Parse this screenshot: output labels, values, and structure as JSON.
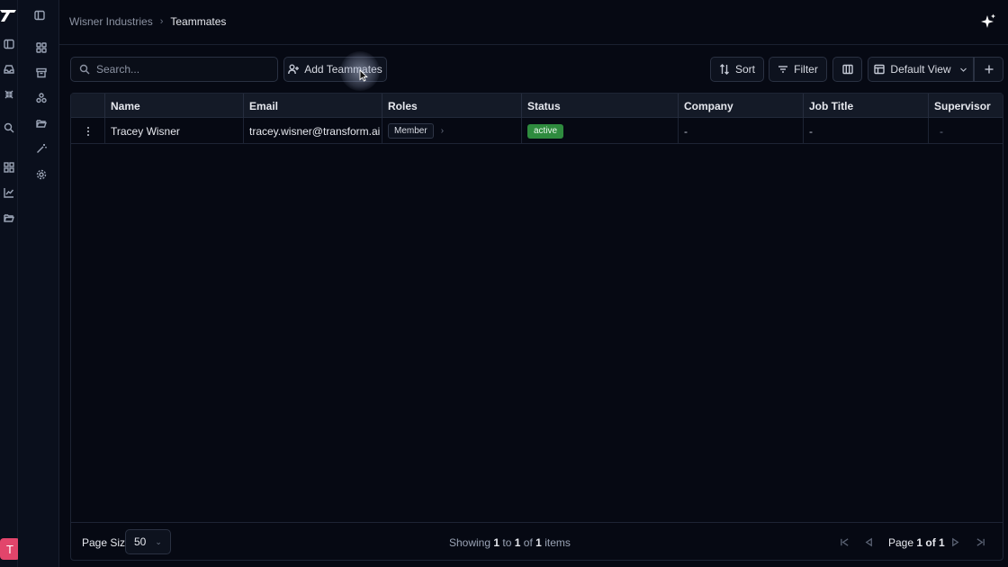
{
  "breadcrumb": {
    "org": "Wisner Industries",
    "current": "Teammates"
  },
  "toolbar": {
    "search_placeholder": "Search...",
    "add_label": "Add Teammates",
    "sort_label": "Sort",
    "filter_label": "Filter",
    "view_label": "Default View"
  },
  "table": {
    "columns": [
      "Name",
      "Email",
      "Roles",
      "Status",
      "Company",
      "Job Title",
      "Supervisor"
    ],
    "rows": [
      {
        "name": "Tracey Wisner",
        "email": "tracey.wisner@transform.ai",
        "role": "Member",
        "status": "active",
        "company": "-",
        "job_title": "-",
        "supervisor": "-"
      }
    ]
  },
  "footer": {
    "page_size_label": "Page Size",
    "page_size_value": "50",
    "showing_prefix": "Showing",
    "showing_from": "1",
    "showing_to_word": "to",
    "showing_to": "1",
    "showing_of_word": "of",
    "showing_total": "1",
    "showing_suffix": "items",
    "page_word": "Page",
    "page_current_label": "1 of 1"
  },
  "user": {
    "avatar_initial": "T"
  },
  "colors": {
    "accent_status": "#2e8b3e",
    "avatar": "#e2456b",
    "background": "#060913"
  }
}
